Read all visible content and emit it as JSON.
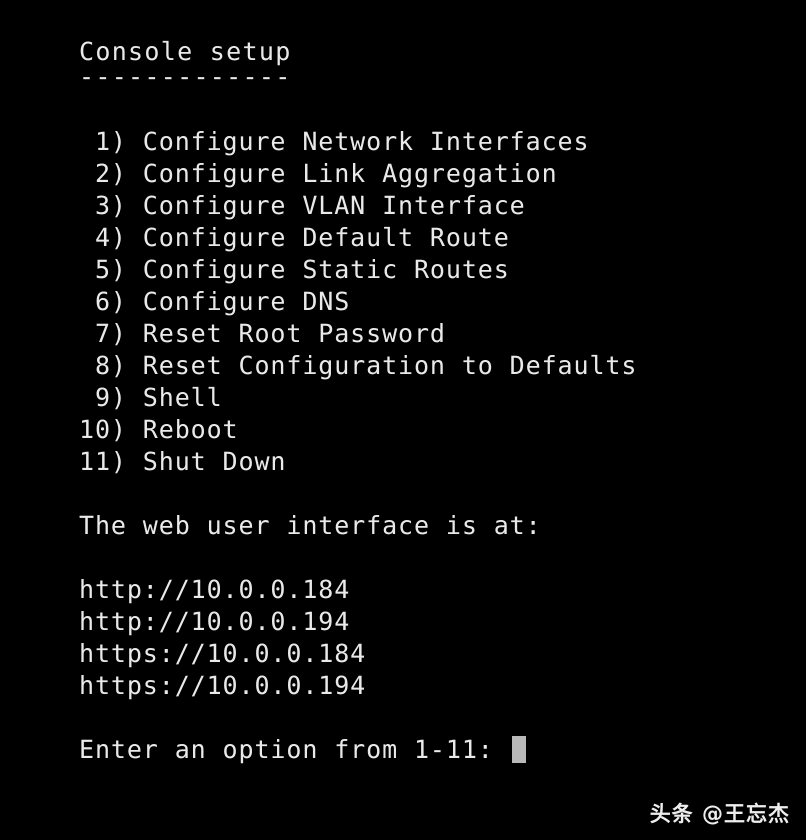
{
  "terminal": {
    "background_color": "#000000",
    "text_color": "#e9e9e9",
    "cursor_color": "#b9b9b9",
    "title": "Console setup",
    "title_rule": "-------------",
    "menu_items": [
      " 1) Configure Network Interfaces",
      " 2) Configure Link Aggregation",
      " 3) Configure VLAN Interface",
      " 4) Configure Default Route",
      " 5) Configure Static Routes",
      " 6) Configure DNS",
      " 7) Reset Root Password",
      " 8) Reset Configuration to Defaults",
      " 9) Shell",
      "10) Reboot",
      "11) Shut Down"
    ],
    "web_ui_heading": "The web user interface is at:",
    "urls": [
      "http://10.0.0.184",
      "http://10.0.0.194",
      "https://10.0.0.184",
      "https://10.0.0.194"
    ],
    "prompt": "Enter an option from 1-11: ",
    "blank": " "
  },
  "watermark": {
    "text": "头条 @王忘杰"
  }
}
